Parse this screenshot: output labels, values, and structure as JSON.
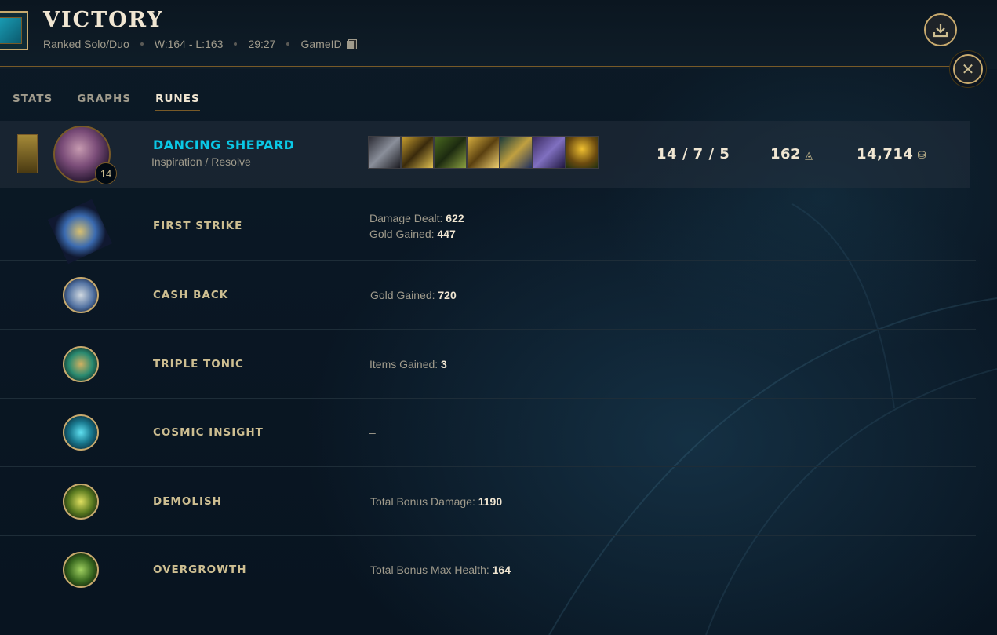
{
  "header": {
    "title": "VICTORY",
    "queue": "Ranked Solo/Duo",
    "record": "W:164 - L:163",
    "duration": "29:27",
    "game_id_label": "GameID"
  },
  "tabs": [
    {
      "label": "STATS"
    },
    {
      "label": "GRAPHS"
    },
    {
      "label": "RUNES",
      "active": true
    }
  ],
  "summary": {
    "player_name": "DANCING SHEPARD",
    "rune_paths": "Inspiration / Resolve",
    "champion_level": "14",
    "kda": "14 / 7 / 5",
    "cs": "162",
    "gold": "14,714"
  },
  "runes": [
    {
      "name": "FIRST STRIKE",
      "stats": [
        {
          "label": "Damage Dealt:",
          "value": "622"
        },
        {
          "label": "Gold Gained:",
          "value": "447"
        }
      ]
    },
    {
      "name": "CASH BACK",
      "stats": [
        {
          "label": "Gold Gained:",
          "value": "720"
        }
      ]
    },
    {
      "name": "TRIPLE TONIC",
      "stats": [
        {
          "label": "Items Gained:",
          "value": "3"
        }
      ]
    },
    {
      "name": "COSMIC INSIGHT",
      "stats": [
        {
          "label": "–",
          "value": ""
        }
      ]
    },
    {
      "name": "DEMOLISH",
      "stats": [
        {
          "label": "Total Bonus Damage:",
          "value": "1190"
        }
      ]
    },
    {
      "name": "OVERGROWTH",
      "stats": [
        {
          "label": "Total Bonus Max Health:",
          "value": "164"
        }
      ]
    }
  ],
  "colors": {
    "gold": "#c8aa6e",
    "player_name": "#0ac8e6",
    "text_light": "#f0e6d2",
    "text_muted": "#a09b8c"
  }
}
